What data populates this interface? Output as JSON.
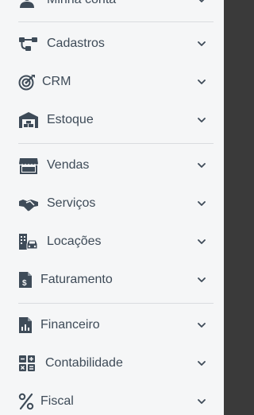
{
  "menu": {
    "items": [
      {
        "label": "Minha conta",
        "icon": "user-icon"
      },
      {
        "label": "Cadastros",
        "icon": "hierarchy-icon"
      },
      {
        "label": "CRM",
        "icon": "target-icon"
      },
      {
        "label": "Estoque",
        "icon": "warehouse-icon"
      },
      {
        "label": "Vendas",
        "icon": "store-icon"
      },
      {
        "label": "Serviços",
        "icon": "handshake-icon"
      },
      {
        "label": "Locações",
        "icon": "building-car-icon"
      },
      {
        "label": "Faturamento",
        "icon": "invoice-dollar-icon"
      },
      {
        "label": "Financeiro",
        "icon": "report-chart-icon"
      },
      {
        "label": "Contabilidade",
        "icon": "calculator-icon"
      },
      {
        "label": "Fiscal",
        "icon": "percent-icon"
      }
    ]
  },
  "colors": {
    "icon": "#3e4b58",
    "text": "#3e4b58",
    "background": "#f5f6f7",
    "divider": "#d9dcdf"
  }
}
